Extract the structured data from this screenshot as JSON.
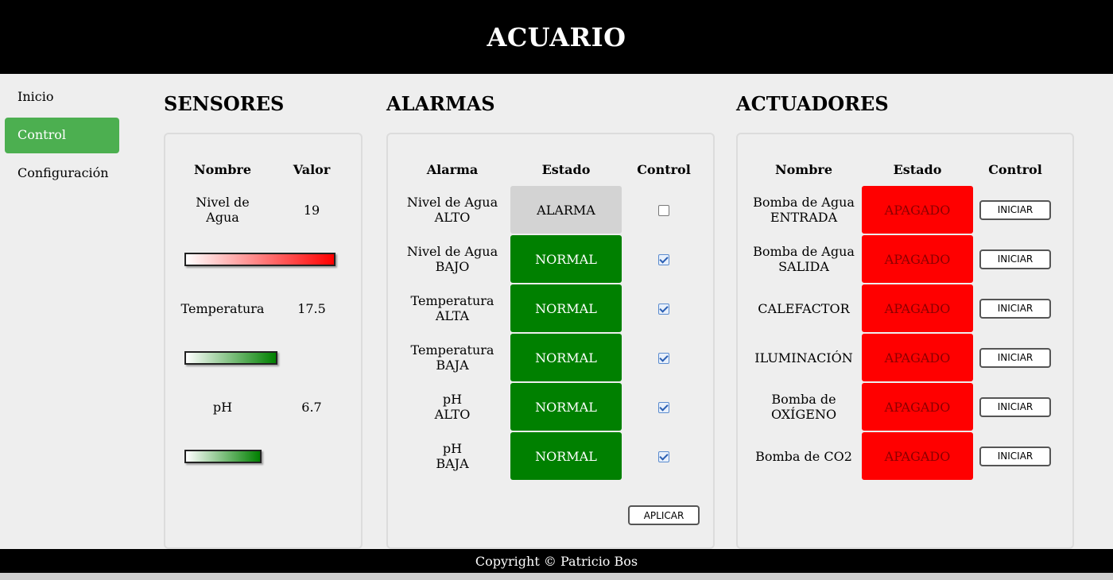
{
  "header": {
    "title": "ACUARIO"
  },
  "sidebar": {
    "items": [
      {
        "label": "Inicio",
        "active": false
      },
      {
        "label": "Control",
        "active": true
      },
      {
        "label": "Configuración",
        "active": false
      }
    ]
  },
  "sensores": {
    "title": "SENSORES",
    "headers": {
      "name": "Nombre",
      "value": "Valor"
    },
    "rows": [
      {
        "name_line1": "Nivel de",
        "name_line2": "Agua",
        "value": "19",
        "bar_color": "#ff0000"
      },
      {
        "name_line1": "Temperatura",
        "name_line2": "",
        "value": "17.5",
        "bar_color": "#008000"
      },
      {
        "name_line1": "pH",
        "name_line2": "",
        "value": "6.7",
        "bar_color": "#008000"
      }
    ]
  },
  "alarmas": {
    "title": "ALARMAS",
    "headers": {
      "alarm": "Alarma",
      "state": "Estado",
      "control": "Control"
    },
    "rows": [
      {
        "line1": "Nivel de Agua",
        "line2": "ALTO",
        "state": "ALARMA",
        "checked": false
      },
      {
        "line1": "Nivel de Agua",
        "line2": "BAJO",
        "state": "NORMAL",
        "checked": true
      },
      {
        "line1": "Temperatura",
        "line2": "ALTA",
        "state": "NORMAL",
        "checked": true
      },
      {
        "line1": "Temperatura",
        "line2": "BAJA",
        "state": "NORMAL",
        "checked": true
      },
      {
        "line1": "pH",
        "line2": "ALTO",
        "state": "NORMAL",
        "checked": true
      },
      {
        "line1": "pH",
        "line2": "BAJA",
        "state": "NORMAL",
        "checked": true
      }
    ],
    "apply_label": "APLICAR"
  },
  "actuadores": {
    "title": "ACTUADORES",
    "headers": {
      "name": "Nombre",
      "state": "Estado",
      "control": "Control"
    },
    "rows": [
      {
        "line1": "Bomba de Agua",
        "line2": "ENTRADA",
        "state": "APAGADO",
        "button": "INICIAR"
      },
      {
        "line1": "Bomba de Agua",
        "line2": "SALIDA",
        "state": "APAGADO",
        "button": "INICIAR"
      },
      {
        "line1": "CALEFACTOR",
        "line2": "",
        "state": "APAGADO",
        "button": "INICIAR"
      },
      {
        "line1": "ILUMINACIÓN",
        "line2": "",
        "state": "APAGADO",
        "button": "INICIAR"
      },
      {
        "line1": "Bomba de",
        "line2": "OXÍGENO",
        "state": "APAGADO",
        "button": "INICIAR"
      },
      {
        "line1": "Bomba de CO2",
        "line2": "",
        "state": "APAGADO",
        "button": "INICIAR"
      }
    ]
  },
  "footer": {
    "text": "Copyright © Patricio Bos"
  },
  "colors": {
    "header_bg": "#000000",
    "nav_active": "#4caf50",
    "normal": "#008000",
    "off": "#ff0000",
    "alarm": "#d3d3d3"
  }
}
